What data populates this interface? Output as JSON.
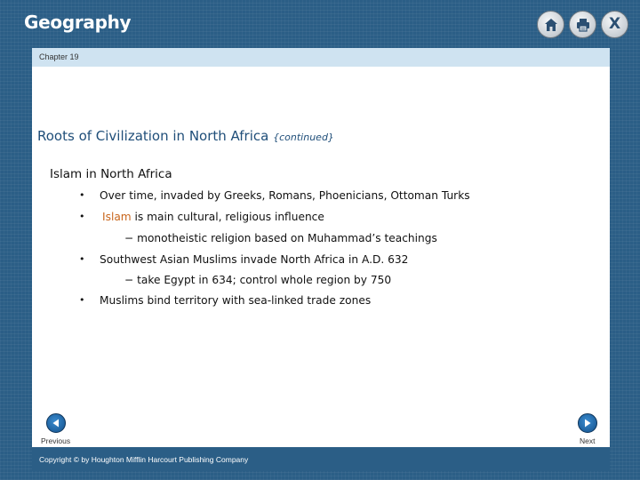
{
  "app": {
    "title": "Geography"
  },
  "toolbar": {
    "home_icon": "home-icon",
    "print_icon": "printer-icon",
    "close_icon": "close-icon",
    "close_glyph": "X"
  },
  "chapter": {
    "label": "Chapter 19"
  },
  "slide": {
    "title": "Roots of Civilization in North Africa",
    "title_suffix": "{continued}",
    "heading": "Islam in North Africa",
    "bullets": [
      {
        "marker": "•",
        "text": "Over time, invaded by Greeks, Romans, Phoenicians, Ottoman Turks"
      },
      {
        "marker": "•",
        "keyword": "Islam",
        "text": " is main cultural, religious influence"
      },
      {
        "marker": "•",
        "text": "Southwest Asian Muslims invade North Africa in A.D. 632"
      },
      {
        "marker": "•",
        "text": "Muslims bind territory with sea-linked trade zones"
      }
    ],
    "subpoints": [
      "− monotheistic religion based on Muhammad’s teachings",
      "− take Egypt in 634; control whole region by 750"
    ]
  },
  "nav": {
    "previous_label": "Previous",
    "next_label": "Next"
  },
  "footer": {
    "copyright": "Copyright © by Houghton Mifflin Harcourt Publishing Company"
  },
  "colors": {
    "brand": "#2b5e86",
    "keyword": "#c8651b",
    "title": "#1f4e79",
    "strip": "#cfe3f1"
  }
}
